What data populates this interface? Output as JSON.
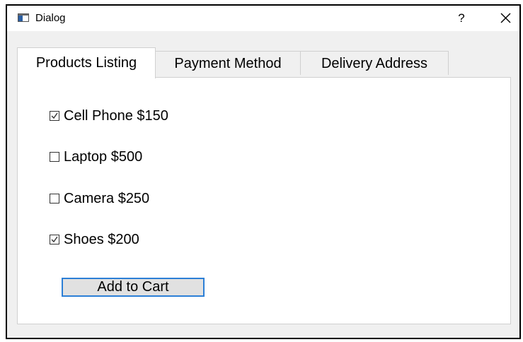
{
  "window": {
    "title": "Dialog",
    "help_label": "?"
  },
  "tabs": [
    {
      "label": "Products Listing",
      "active": true
    },
    {
      "label": "Payment Method",
      "active": false
    },
    {
      "label": "Delivery Address",
      "active": false
    }
  ],
  "products": [
    {
      "label": "Cell Phone $150",
      "checked": true
    },
    {
      "label": "Laptop $500",
      "checked": false
    },
    {
      "label": "Camera $250",
      "checked": false
    },
    {
      "label": "Shoes $200",
      "checked": true
    }
  ],
  "actions": {
    "add_to_cart_label": "Add to Cart"
  },
  "colors": {
    "focus_border": "#2c7fd6",
    "window_border": "#000000",
    "panel_background": "#ffffff",
    "chrome_background": "#f0f0f0"
  }
}
